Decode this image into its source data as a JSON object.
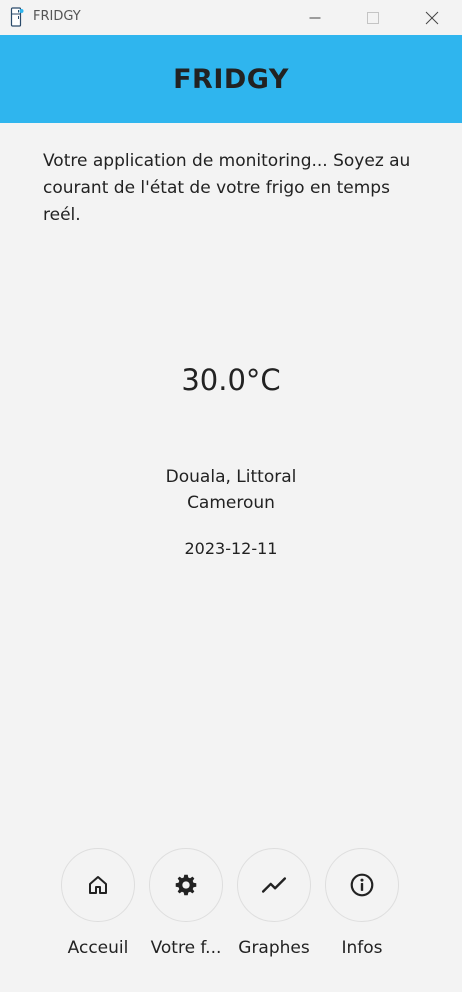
{
  "window": {
    "title": "FRIDGY"
  },
  "header": {
    "title": "FRIDGY",
    "background": "#2fb5ee"
  },
  "intro": {
    "text": "Votre application de monitoring... Soyez au courant de l'état de votre frigo en temps reél."
  },
  "reading": {
    "temperature": "30.0°C",
    "city": "Douala, Littoral",
    "country": "Cameroun",
    "date": "2023-12-11"
  },
  "nav": {
    "items": [
      {
        "label": "Acceuil",
        "icon": "home-icon"
      },
      {
        "label": "Votre f...",
        "icon": "gear-icon"
      },
      {
        "label": "Graphes",
        "icon": "line-chart-icon"
      },
      {
        "label": "Infos",
        "icon": "info-icon"
      }
    ]
  }
}
